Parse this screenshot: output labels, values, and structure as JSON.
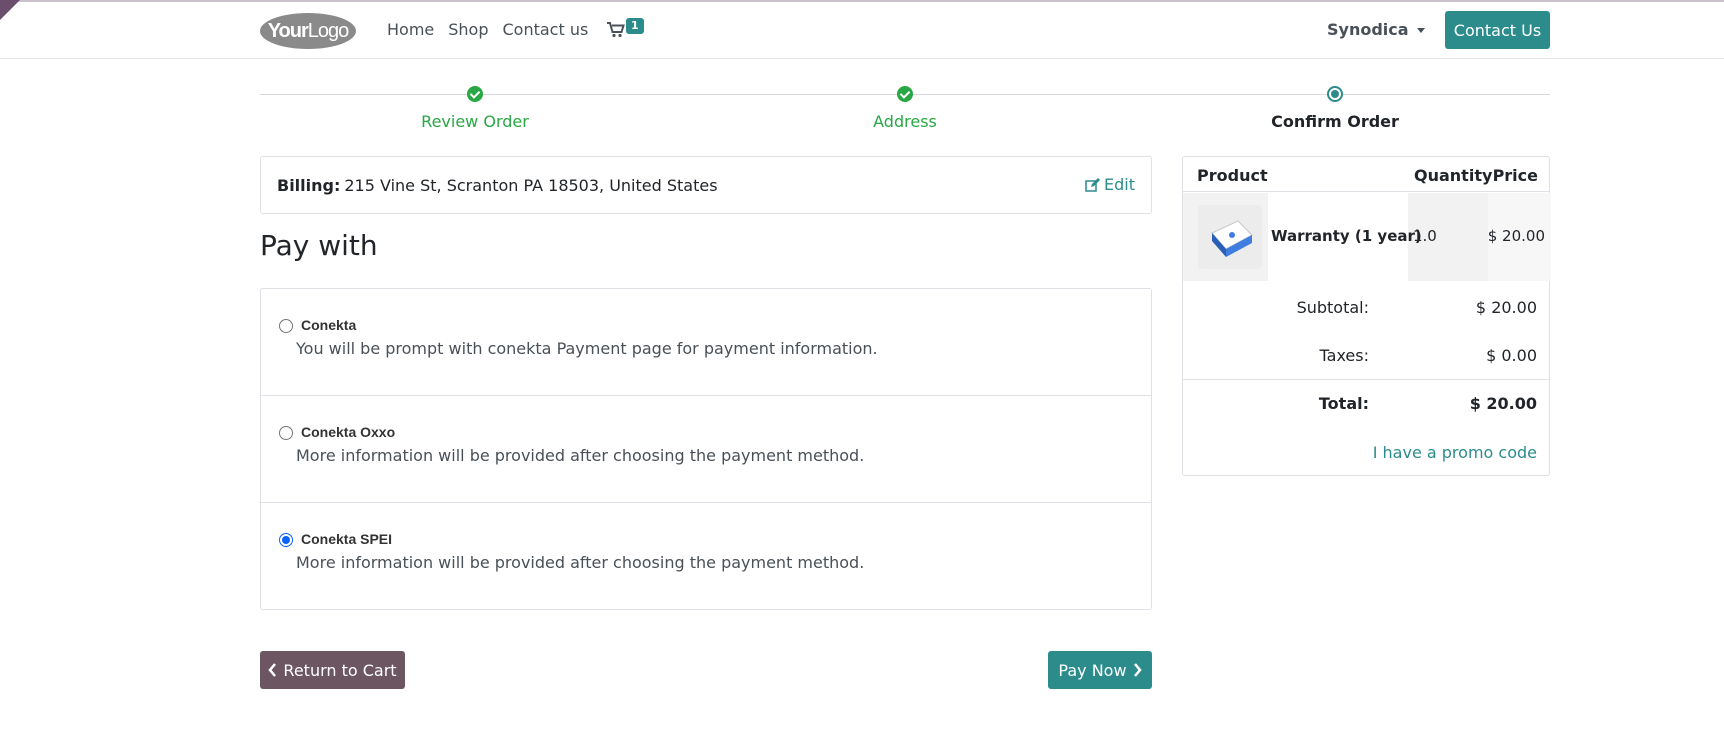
{
  "header": {
    "logo": {
      "bold": "Your",
      "thin": "Logo"
    },
    "nav": [
      "Home",
      "Shop",
      "Contact us"
    ],
    "cart_count": "1",
    "user": "Synodica",
    "contact_button": "Contact Us",
    "icons": {
      "cart": "shopping-cart-icon",
      "caret": "caret-down-icon"
    }
  },
  "steps": [
    {
      "label": "Review Order",
      "state": "done"
    },
    {
      "label": "Address",
      "state": "done"
    },
    {
      "label": "Confirm Order",
      "state": "current"
    }
  ],
  "billing": {
    "label": "Billing:",
    "address": "215 Vine St, Scranton PA 18503, United States",
    "edit_label": "Edit"
  },
  "pay_with_title": "Pay with",
  "payment_methods": [
    {
      "name": "Conekta",
      "description": "You will be prompt with conekta Payment page for payment information.",
      "selected": false
    },
    {
      "name": "Conekta Oxxo",
      "description": "More information will be provided after choosing the payment method.",
      "selected": false
    },
    {
      "name": "Conekta SPEI",
      "description": "More information will be provided after choosing the payment method.",
      "selected": true
    }
  ],
  "buttons": {
    "return": "Return to Cart",
    "pay": "Pay Now"
  },
  "summary": {
    "columns": [
      "Product",
      "Quantity",
      "Price"
    ],
    "item": {
      "name": "Warranty (1 year)",
      "quantity": "1.0",
      "price": "$ 20.00"
    },
    "subtotal_label": "Subtotal:",
    "subtotal": "$ 20.00",
    "taxes_label": "Taxes:",
    "taxes": "$ 0.00",
    "total_label": "Total:",
    "total": "$ 20.00",
    "promo": "I have a promo code"
  },
  "colors": {
    "primary": "#2c8c8c",
    "secondary": "#6b5662",
    "success": "#28a745"
  }
}
